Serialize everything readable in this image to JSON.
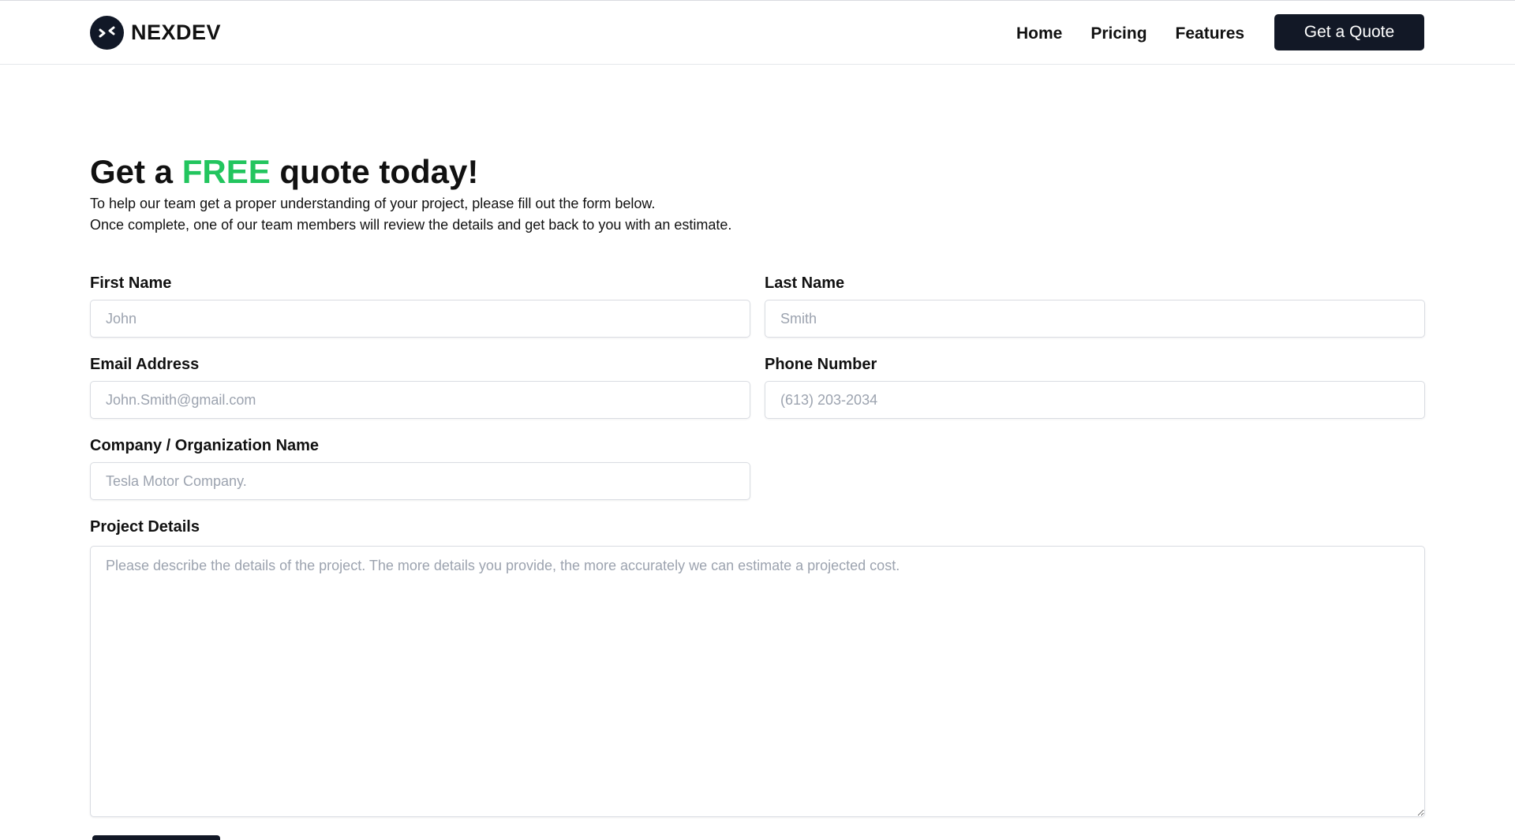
{
  "nav": {
    "brand": "NEXDEV",
    "links": [
      {
        "label": "Home"
      },
      {
        "label": "Pricing"
      },
      {
        "label": "Features"
      }
    ],
    "cta_label": "Get a Quote"
  },
  "hero": {
    "title_prefix": "Get a ",
    "title_accent": "FREE",
    "title_suffix": " quote today!",
    "intro_line_1": "To help our team get a proper understanding of your project, please fill out the form below.",
    "intro_line_2": "Once complete, one of our team members will review the details and get back to you with an estimate."
  },
  "form": {
    "first_name": {
      "label": "First Name",
      "placeholder": "John",
      "value": ""
    },
    "last_name": {
      "label": "Last Name",
      "placeholder": "Smith",
      "value": ""
    },
    "email": {
      "label": "Email Address",
      "placeholder": "John.Smith@gmail.com",
      "value": ""
    },
    "phone": {
      "label": "Phone Number",
      "placeholder": "(613) 203-2034",
      "value": ""
    },
    "company": {
      "label": "Company / Organization Name",
      "placeholder": "Tesla Motor Company.",
      "value": ""
    },
    "details": {
      "label": "Project Details",
      "placeholder": "Please describe the details of the project. The more details you provide, the more accurately we can estimate a projected cost.",
      "value": ""
    }
  },
  "colors": {
    "accent": "#22c55e",
    "primary_dark": "#121826",
    "border": "#d9dce2",
    "placeholder": "#9ca3af"
  },
  "icons": {
    "brand_logo": "code-arrows-icon"
  }
}
